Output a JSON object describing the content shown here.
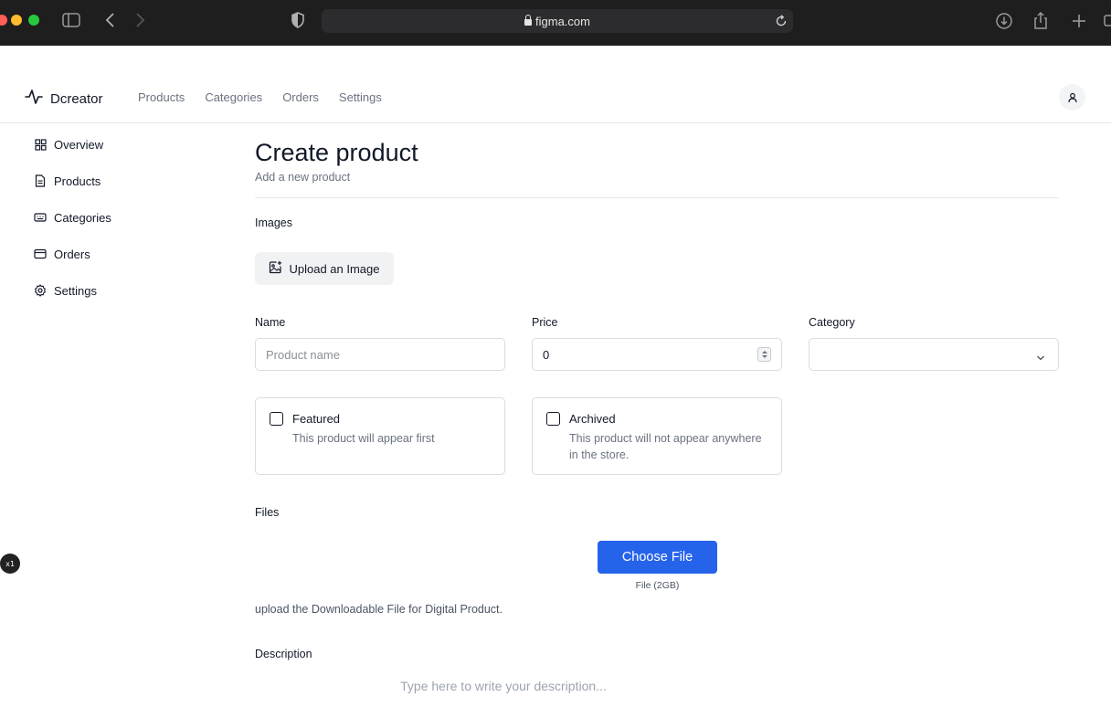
{
  "browser": {
    "url": "figma.com"
  },
  "app": {
    "brand": "Dcreator",
    "topnav": [
      "Products",
      "Categories",
      "Orders",
      "Settings"
    ]
  },
  "sidebar": {
    "items": [
      {
        "label": "Overview",
        "icon": "grid-icon"
      },
      {
        "label": "Products",
        "icon": "file-icon"
      },
      {
        "label": "Categories",
        "icon": "keyboard-icon"
      },
      {
        "label": "Orders",
        "icon": "card-icon"
      },
      {
        "label": "Settings",
        "icon": "gear-icon"
      }
    ]
  },
  "page": {
    "title": "Create product",
    "subtitle": "Add a new product"
  },
  "form": {
    "images_label": "Images",
    "upload_label": "Upload an Image",
    "name_label": "Name",
    "name_placeholder": "Product name",
    "price_label": "Price",
    "price_value": "0",
    "category_label": "Category",
    "category_value": "",
    "featured": {
      "title": "Featured",
      "desc": "This product will appear first",
      "checked": false
    },
    "archived": {
      "title": "Archived",
      "desc": "This product will not appear anywhere in the store.",
      "checked": false
    },
    "files_label": "Files",
    "choose_file_label": "Choose File",
    "file_size": "File (2GB)",
    "file_help": "upload the Downloadable File for Digital Product.",
    "description_label": "Description",
    "description_placeholder": "Type here to write your description..."
  },
  "badge": {
    "text": "x1"
  },
  "colors": {
    "primary": "#2563eb",
    "chrome": "#1e1e1e",
    "border": "#d9dce1"
  }
}
